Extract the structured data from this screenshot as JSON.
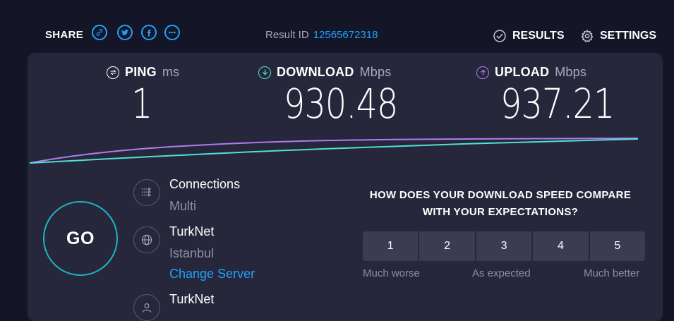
{
  "header": {
    "share_label": "SHARE",
    "share_icons": [
      "link-icon",
      "twitter-icon",
      "facebook-icon",
      "more-icon"
    ],
    "result_id_label": "Result ID",
    "result_id_value": "12565672318",
    "results_label": "RESULTS",
    "settings_label": "SETTINGS"
  },
  "metrics": {
    "ping": {
      "label": "PING",
      "unit": "ms",
      "value": "1"
    },
    "download": {
      "label": "DOWNLOAD",
      "unit": "Mbps",
      "value": "930.48"
    },
    "upload": {
      "label": "UPLOAD",
      "unit": "Mbps",
      "value": "937.21"
    }
  },
  "go_label": "GO",
  "info": {
    "connections": {
      "title": "Connections",
      "value": "Multi"
    },
    "server": {
      "title": "TurkNet",
      "location": "Istanbul",
      "change_link": "Change Server"
    },
    "provider": {
      "title": "TurkNet"
    }
  },
  "survey": {
    "question_line1": "HOW DOES YOUR DOWNLOAD SPEED COMPARE",
    "question_line2": "WITH YOUR EXPECTATIONS?",
    "options": [
      "1",
      "2",
      "3",
      "4",
      "5"
    ],
    "low_label": "Much worse",
    "mid_label": "As expected",
    "high_label": "Much better"
  },
  "colors": {
    "background": "#141526",
    "panel": "#26273b",
    "accent_blue": "#1ea2ff",
    "download_cyan": "#4fe1d4",
    "upload_purple": "#b07cf0"
  }
}
